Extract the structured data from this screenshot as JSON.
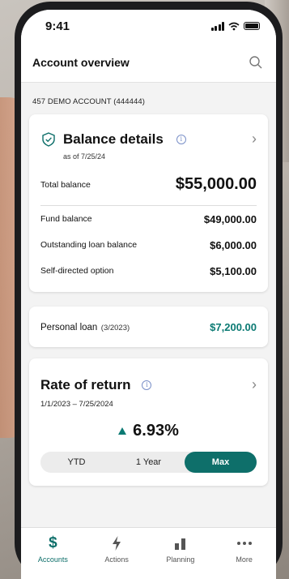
{
  "status_bar": {
    "time": "9:41"
  },
  "header": {
    "title": "Account overview"
  },
  "account": {
    "label": "457 DEMO ACCOUNT (444444)"
  },
  "balance": {
    "title": "Balance details",
    "as_of": "as of 7/25/24",
    "total_label": "Total balance",
    "total_value": "$55,000.00",
    "rows": [
      {
        "label": "Fund balance",
        "value": "$49,000.00"
      },
      {
        "label": "Outstanding loan balance",
        "value": "$6,000.00"
      },
      {
        "label": "Self-directed option",
        "value": "$5,100.00"
      }
    ]
  },
  "loan": {
    "label": "Personal loan",
    "date": "(3/2023)",
    "value": "$7,200.00"
  },
  "rate_of_return": {
    "title": "Rate of return",
    "range": "1/1/2023 – 7/25/2024",
    "value": "6.93%",
    "options": [
      "YTD",
      "1 Year",
      "Max"
    ],
    "selected": "Max"
  },
  "tabbar": {
    "tabs": [
      {
        "label": "Accounts",
        "icon": "dollar-icon",
        "active": true
      },
      {
        "label": "Actions",
        "icon": "lightning-icon",
        "active": false
      },
      {
        "label": "Planning",
        "icon": "bar-chart-icon",
        "active": false
      },
      {
        "label": "More",
        "icon": "more-dots-icon",
        "active": false
      }
    ]
  },
  "colors": {
    "accent": "#0e6f6a",
    "positive": "#0b7a73",
    "info": "#7a90c8"
  }
}
